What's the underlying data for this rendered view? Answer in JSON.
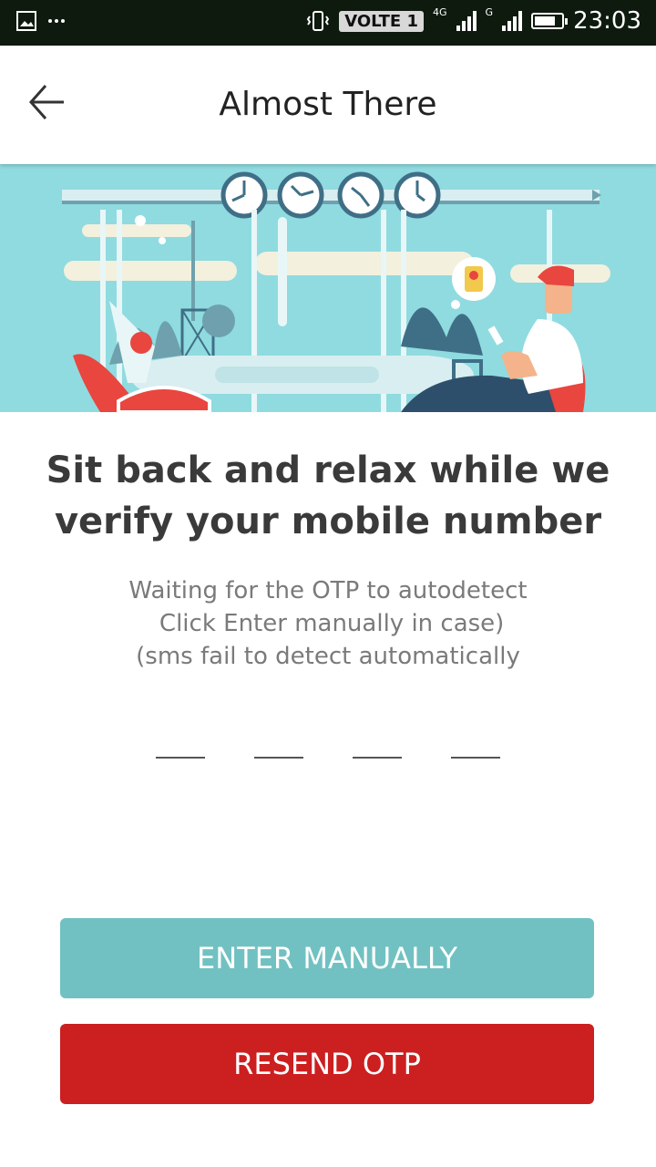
{
  "status_bar": {
    "volte_label": "VOLTE 1",
    "network_1": "4G",
    "network_2": "G",
    "battery_percent": 80,
    "time": "23:03",
    "icons": [
      "image-icon",
      "more-dots-icon",
      "vibrate-icon",
      "signal-icon",
      "battery-icon"
    ]
  },
  "app_bar": {
    "title": "Almost There",
    "back_icon": "arrow-left-icon"
  },
  "hero": {
    "illustration": "airport-lounge-illustration",
    "colors": {
      "sky": "#8fdbe0",
      "accent": "#e8463f"
    }
  },
  "content": {
    "headline_line1": "Sit back and relax while we",
    "headline_line2": "verify your mobile number",
    "sub_line1": "Waiting for the OTP to autodetect",
    "sub_line2": " Click Enter manually in case)",
    "sub_line3": "(sms fail to detect automatically"
  },
  "otp": {
    "slots": [
      "",
      "",
      "",
      ""
    ]
  },
  "buttons": {
    "enter_manually": "ENTER MANUALLY",
    "resend_otp": "RESEND OTP",
    "colors": {
      "enter": "#72c1c2",
      "resend": "#cc1f20"
    }
  }
}
